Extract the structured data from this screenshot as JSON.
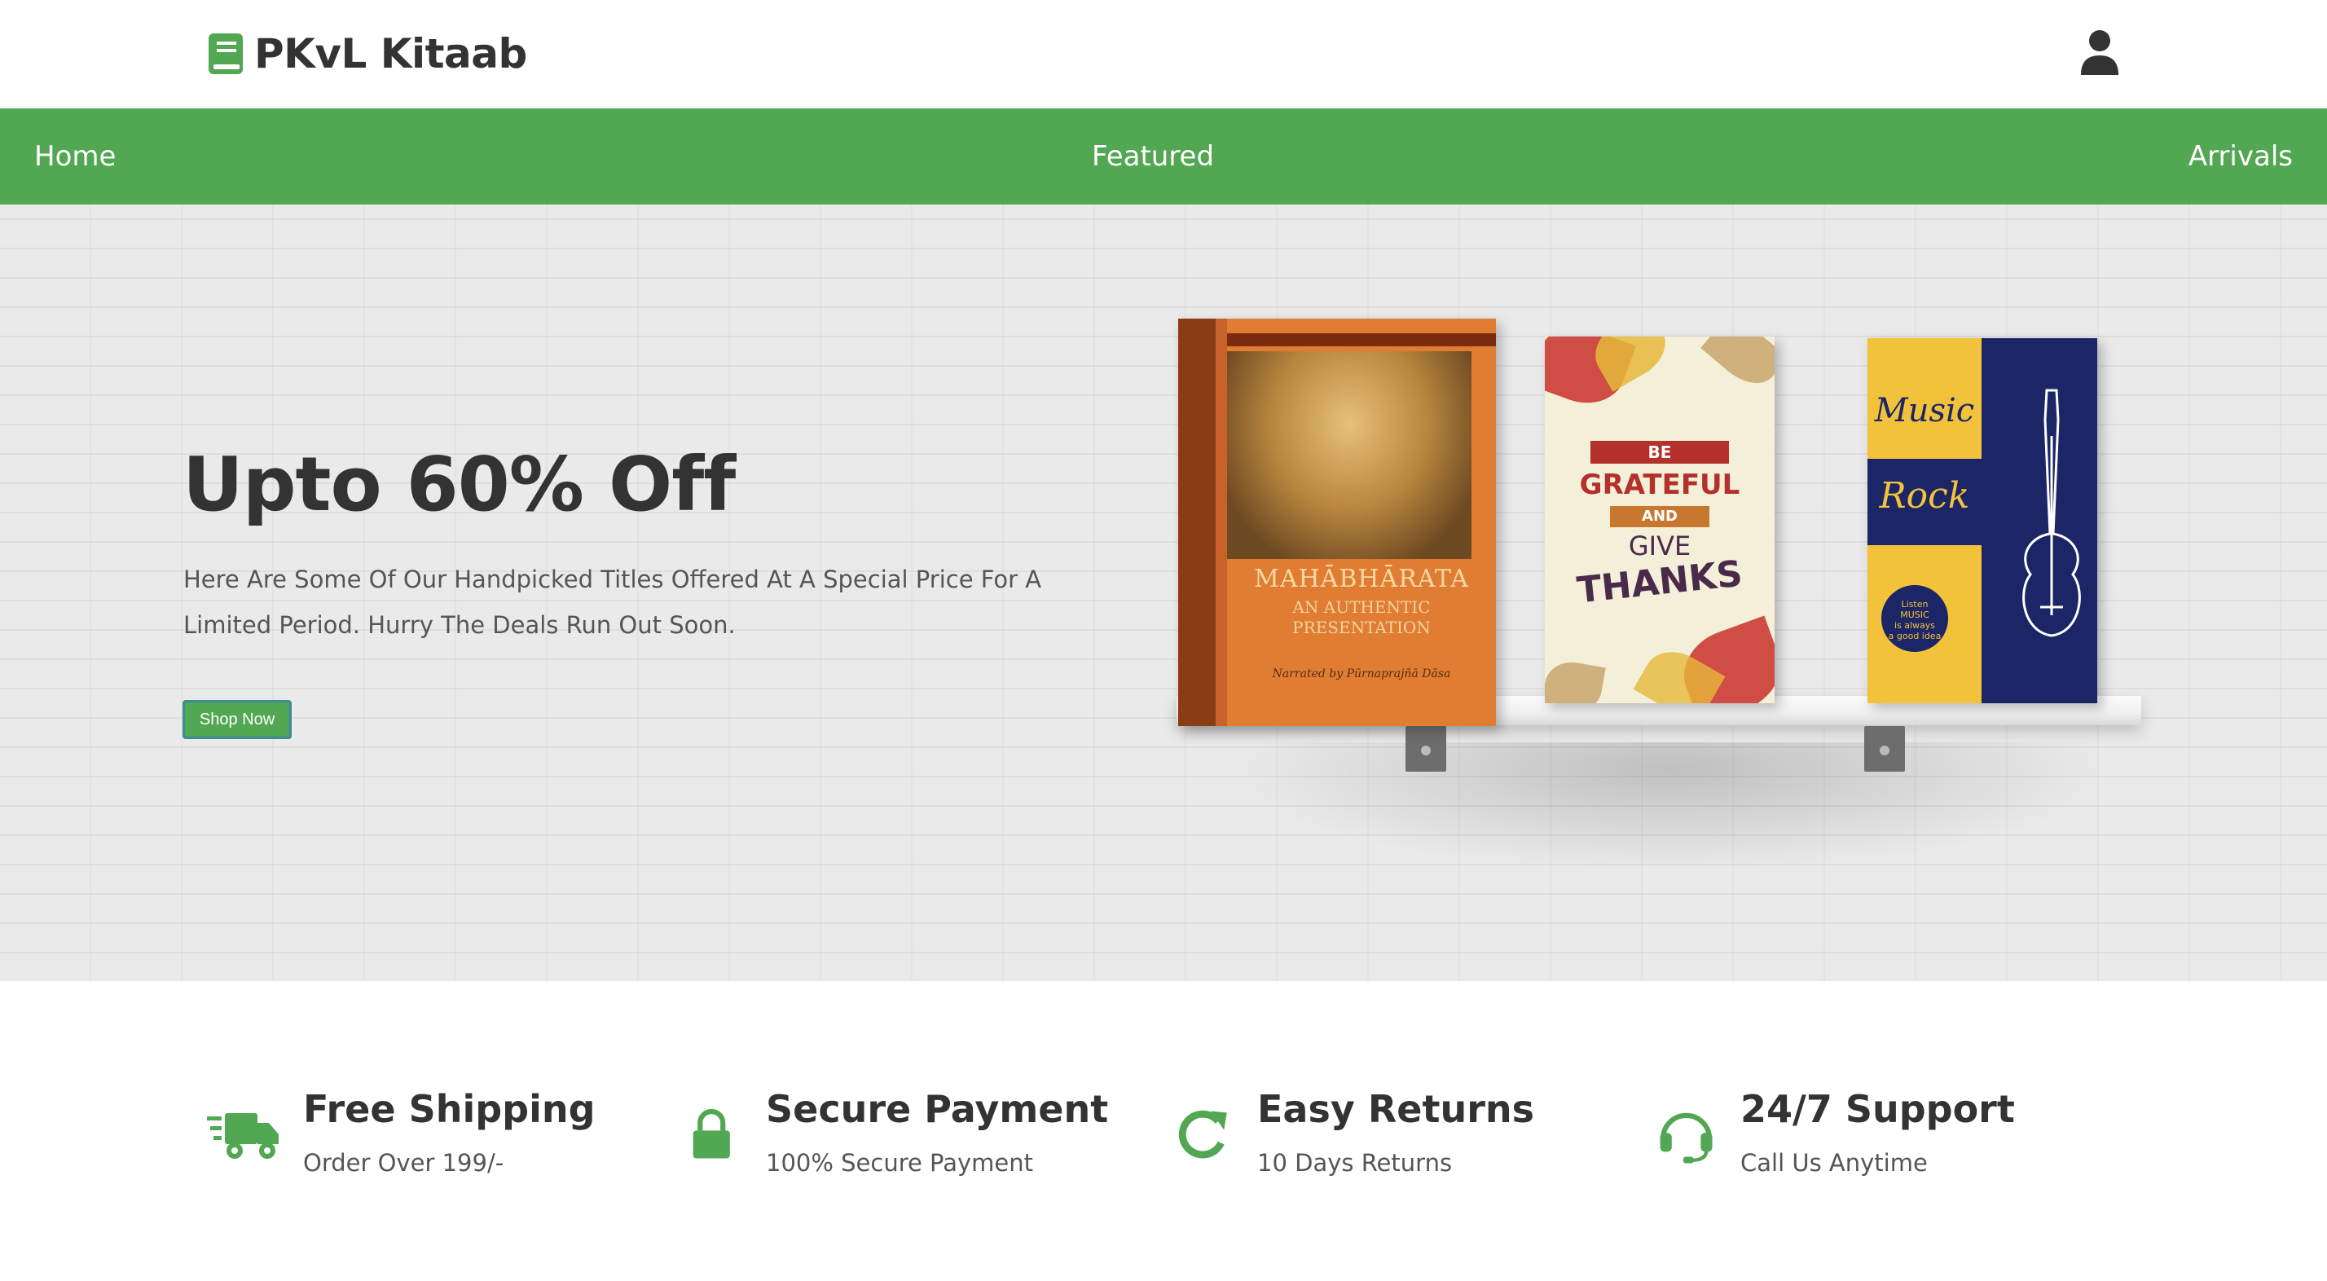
{
  "brand": {
    "name": "PKvL Kitaab",
    "accent_color": "#52a752",
    "logo_icon": "book-icon"
  },
  "header": {
    "user_icon": "user-icon"
  },
  "nav": {
    "home": "Home",
    "featured": "Featured",
    "arrivals": "Arrivals"
  },
  "hero": {
    "title": "Upto 60% Off",
    "description": "Here Are Some Of Our Handpicked Titles Offered At A Special Price For A Limited Period. Hurry The Deals Run Out Soon.",
    "button": "Shop Now",
    "books": [
      {
        "title": "MAHĀBHĀRATA",
        "subtitle_line1": "AN AUTHENTIC",
        "subtitle_line2": "PRESENTATION",
        "narrator": "Narrated by Pūrnaprajñā Dāsa"
      },
      {
        "be": "BE",
        "grateful": "GRATEFUL",
        "and": "AND",
        "give": "GIVE",
        "thanks": "THANKS"
      },
      {
        "music": "Music",
        "rock": "Rock",
        "badge_line1": "Listen",
        "badge_line2": "MUSIC",
        "badge_line3": "is always",
        "badge_line4": "a good idea"
      }
    ]
  },
  "features": [
    {
      "icon": "truck-icon",
      "title": "Free Shipping",
      "subtitle": "Order Over 199/-"
    },
    {
      "icon": "lock-icon",
      "title": "Secure Payment",
      "subtitle": "100% Secure Payment"
    },
    {
      "icon": "redo-icon",
      "title": "Easy Returns",
      "subtitle": "10 Days Returns"
    },
    {
      "icon": "headset-icon",
      "title": "24/7 Support",
      "subtitle": "Call Us Anytime"
    }
  ]
}
